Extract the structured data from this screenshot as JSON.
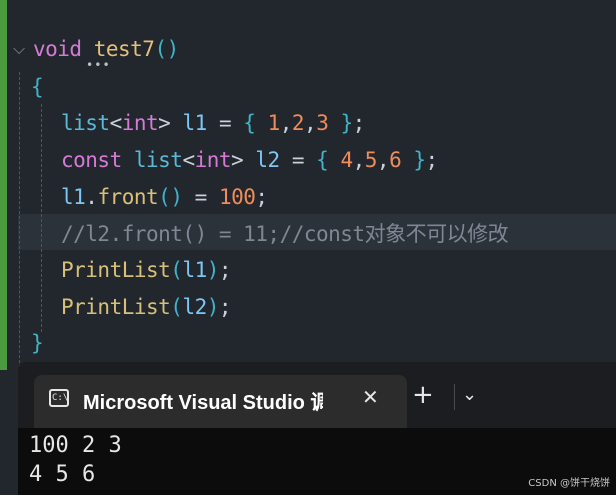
{
  "code": {
    "l1": {
      "kw": "void",
      "name": "test7",
      "parens": "()"
    },
    "l2": {
      "brace": "{"
    },
    "l3": {
      "type": "list",
      "lt": "<",
      "tp": "int",
      "gt": ">",
      "var": "l1",
      "eq": "=",
      "ob": "{",
      "n1": "1",
      "c1": ",",
      "n2": "2",
      "c2": ",",
      "n3": "3",
      "cb": "}",
      "semi": ";"
    },
    "l4": {
      "kw": "const",
      "type": "list",
      "lt": "<",
      "tp": "int",
      "gt": ">",
      "var": "l2",
      "eq": "=",
      "ob": "{",
      "n1": "4",
      "c1": ",",
      "n2": "5",
      "c2": ",",
      "n3": "6",
      "cb": "}",
      "semi": ";"
    },
    "l5": {
      "var": "l1",
      "dot": ".",
      "method": "front",
      "parens": "()",
      "eq": "=",
      "num": "100",
      "semi": ";"
    },
    "l6": {
      "comment": "//l2.front() = 11;//const对象不可以修改"
    },
    "l7": {
      "fn": "PrintList",
      "op": "(",
      "arg": "l1",
      "cp": ")",
      "semi": ";"
    },
    "l8": {
      "fn": "PrintList",
      "op": "(",
      "arg": "l2",
      "cp": ")",
      "semi": ";"
    },
    "l9": {
      "brace": "}"
    },
    "fold_icon": "chevron-down"
  },
  "terminal": {
    "tab_title": "Microsoft Visual Studio 调",
    "tab_icon_text": "C:\\",
    "close_glyph": "✕",
    "plus_glyph": "+",
    "chevron_glyph": "⌄",
    "output": [
      "100 2 3",
      "4 5 6"
    ]
  },
  "watermark": "CSDN @饼干烧饼"
}
